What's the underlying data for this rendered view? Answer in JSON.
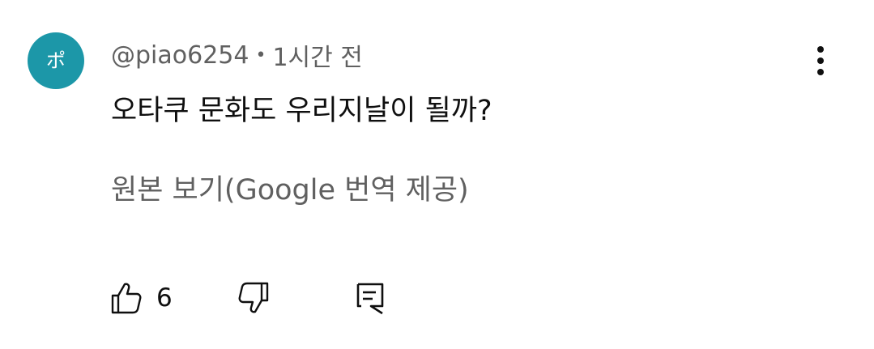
{
  "comment": {
    "avatar_letter": "ポ",
    "avatar_color": "#1c97a8",
    "author": "@piao6254",
    "separator": "•",
    "time_ago": "1시간 전",
    "text": "오타쿠 문화도 우리지날이 될까?",
    "translate_link": "원본 보기(Google 번역 제공)",
    "like_count": "6",
    "icons": {
      "like": "thumbs-up-outline-icon",
      "dislike": "thumbs-down-outline-icon",
      "reply": "comment-outline-icon",
      "more": "vertical-ellipsis-icon"
    }
  }
}
